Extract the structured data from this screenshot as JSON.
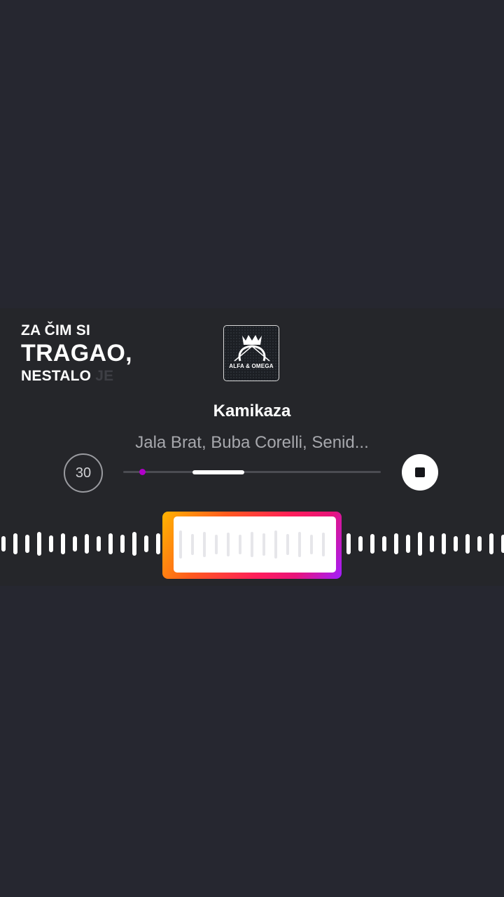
{
  "lyrics": {
    "line1": "ZA ČIM SI",
    "line2": "TRAGAO,",
    "line3_main": "NESTALO",
    "line3_faded": "JE"
  },
  "song": {
    "cover_text": "ALFA & OMEGA",
    "title": "Kamikaza",
    "artists": "Jala Brat, Buba Corelli, Senid..."
  },
  "controls": {
    "clip_length": "30",
    "progress_start_fraction": 0.27,
    "progress_end_fraction": 0.47,
    "stop_icon": "stop-icon",
    "timer_icon": "timer-30-icon"
  },
  "colors": {
    "background": "#262730",
    "accent_purple": "#b000c8"
  }
}
